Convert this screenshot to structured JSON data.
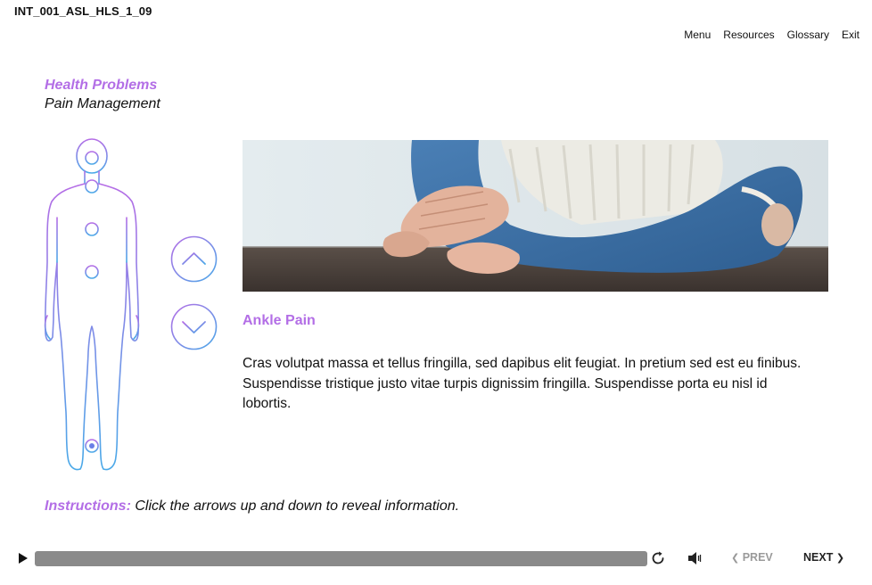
{
  "course": {
    "id": "INT_001_ASL_HLS_1_09"
  },
  "nav": {
    "menu": "Menu",
    "resources": "Resources",
    "glossary": "Glossary",
    "exit": "Exit"
  },
  "heading": {
    "section": "Health Problems",
    "topic": "Pain Management"
  },
  "content": {
    "title": "Ankle Pain",
    "body": "Cras volutpat massa et tellus fringilla, sed dapibus elit feugiat. In pretium sed est eu finibus. Suspendisse tristique justo vitae turpis dignissim fringilla. Suspendisse porta eu nisl id lobortis."
  },
  "instructions": {
    "lead": "Instructions:",
    "text": " Click the arrows up and down to reveal information."
  },
  "player": {
    "prev": "PREV",
    "next": "NEXT"
  },
  "icons": {
    "figure": "body-figure-icon",
    "up": "chevron-up-icon",
    "down": "chevron-down-icon",
    "play": "play-icon",
    "replay": "replay-icon",
    "volume": "volume-icon"
  },
  "colors": {
    "accent": "#b36ee6",
    "gradient_top": "#b56de6",
    "gradient_bottom": "#4aa9e8",
    "progress": "#8a8a8a"
  }
}
